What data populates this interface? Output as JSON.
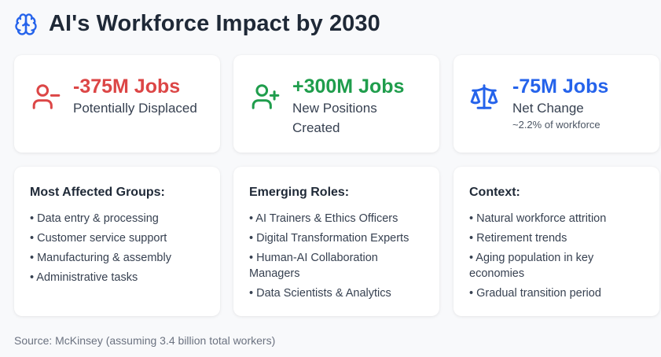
{
  "header": {
    "icon": "brain-icon",
    "title": "AI's Workforce Impact by 2030"
  },
  "stats": [
    {
      "icon": "user-minus-icon",
      "value": "-375M Jobs",
      "label": "Potentially Displaced",
      "color": "#dc4646"
    },
    {
      "icon": "user-plus-icon",
      "value": "+300M Jobs",
      "label": "New Positions Created",
      "color": "#1f9d4c"
    },
    {
      "icon": "scale-icon",
      "value": "-75M Jobs",
      "label": "Net Change",
      "sub": "~2.2% of workforce",
      "color": "#2563eb"
    }
  ],
  "panels": [
    {
      "title": "Most Affected Groups:",
      "items": [
        "• Data entry & processing",
        "• Customer service support",
        "• Manufacturing & assembly",
        "• Administrative tasks"
      ]
    },
    {
      "title": "Emerging Roles:",
      "items": [
        "• AI Trainers & Ethics Officers",
        "• Digital Transformation Experts",
        "• Human-AI Collaboration Managers",
        "• Data Scientists & Analytics"
      ]
    },
    {
      "title": "Context:",
      "items": [
        "• Natural workforce attrition",
        "• Retirement trends",
        "• Aging population in key economies",
        "• Gradual transition period"
      ]
    }
  ],
  "footer": {
    "source": "Source: McKinsey (assuming 3.4 billion total workers)"
  },
  "colors": {
    "accent": "#2563eb",
    "negative": "#dc4646",
    "positive": "#1f9d4c"
  }
}
